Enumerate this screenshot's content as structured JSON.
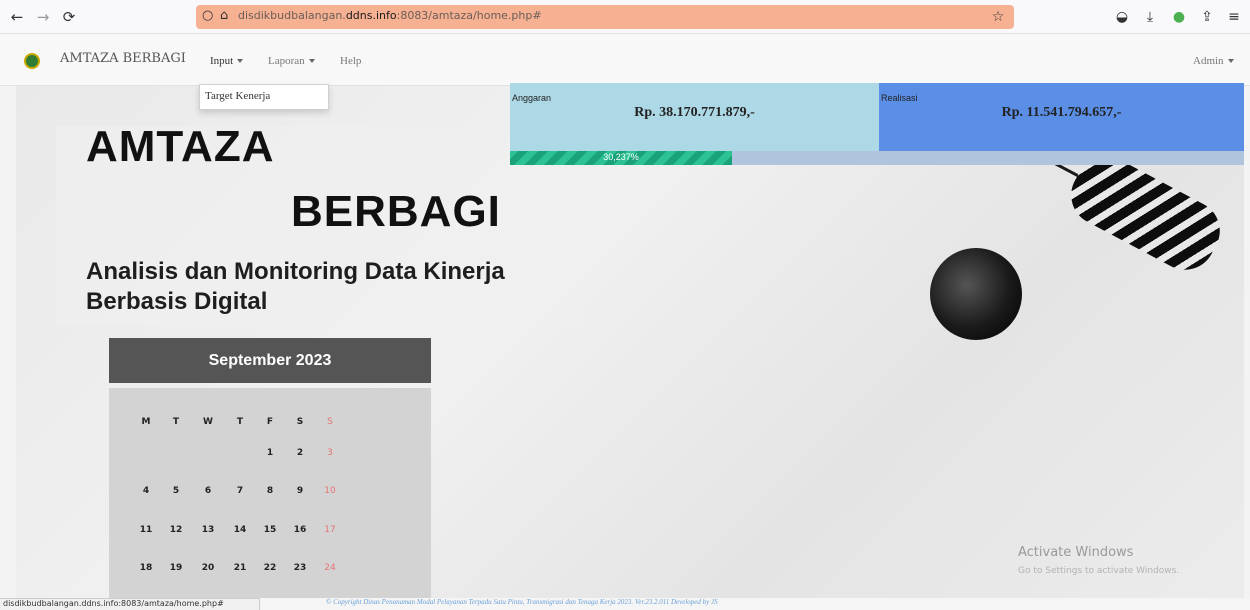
{
  "browser": {
    "url_prefix": "disdikbudbalangan.",
    "url_domain": "ddns.info",
    "url_suffix": ":8083/amtaza/home.php#",
    "status_url": "disdikbudbalangan.ddns.info:8083/amtaza/home.php#"
  },
  "nav": {
    "brand": "AMTAZA BERBAGI",
    "menus": [
      {
        "label": "Input"
      },
      {
        "label": "Laporan"
      },
      {
        "label": "Help"
      }
    ],
    "user": "Admin",
    "dropdown_item": "Target Kenerja"
  },
  "hero": {
    "title_line1": "AMTAZA",
    "title_line2": "BERBAGI",
    "subtitle_line1": "Analisis dan Monitoring Data Kinerja",
    "subtitle_line2": "Berbasis Digital"
  },
  "budget": {
    "anggaran_label": "Anggaran",
    "anggaran_value": "Rp. 38.170.771.879,-",
    "realisasi_label": "Realisasi",
    "realisasi_value": "Rp. 11.541.794.657,-",
    "progress_text": "30,237%",
    "progress_percent": 30.237,
    "colors": {
      "anggaran": "#add8e6",
      "realisasi": "#5b8fe6",
      "progress": "#1aa37a"
    }
  },
  "calendar": {
    "month": "September 2023",
    "days": [
      "M",
      "T",
      "W",
      "T",
      "F",
      "S",
      "S"
    ],
    "weeks": [
      [
        "",
        "",
        "",
        "",
        "1",
        "2",
        "3"
      ],
      [
        "4",
        "5",
        "6",
        "7",
        "8",
        "9",
        "10"
      ],
      [
        "11",
        "12",
        "13",
        "14",
        "15",
        "16",
        "17"
      ],
      [
        "18",
        "19",
        "20",
        "21",
        "22",
        "23",
        "24"
      ]
    ]
  },
  "watermark": {
    "line1": "Activate Windows",
    "line2": "Go to Settings to activate Windows."
  },
  "footer": "© Copyright Dinas Penanaman Modal Pelayanan Terpadu Satu Pintu, Transmigrasi dan Tenaga Kerja 2023. Ver.23.2.011 Developed by JS"
}
